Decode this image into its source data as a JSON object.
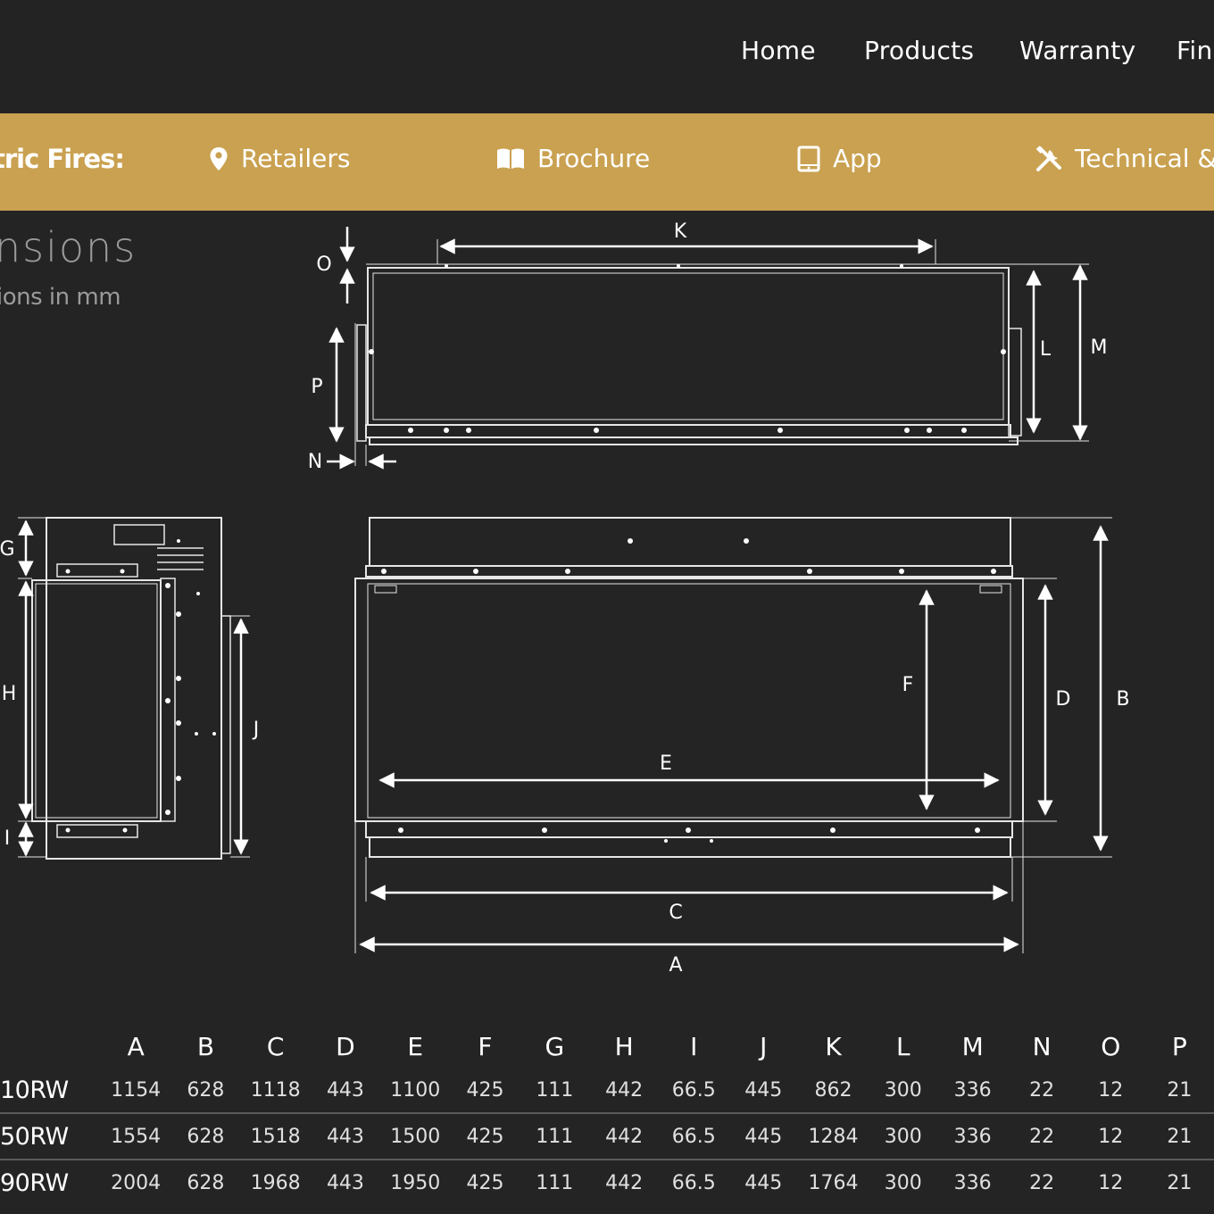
{
  "nav": {
    "home": "Home",
    "products": "Products",
    "warranty": "Warranty",
    "find": "Find"
  },
  "subnav": {
    "title": "tric Fires:",
    "retailers": "Retailers",
    "brochure": "Brochure",
    "app": "App",
    "technical": "Technical & S"
  },
  "section": {
    "heading": "nsions",
    "subheading": "ions in mm"
  },
  "diagram_labels": {
    "A": "A",
    "B": "B",
    "C": "C",
    "D": "D",
    "E": "E",
    "F": "F",
    "G": "G",
    "H": "H",
    "I": "I",
    "J": "J",
    "K": "K",
    "L": "L",
    "M": "M",
    "N": "N",
    "O": "O",
    "P": "P"
  },
  "table": {
    "headers": [
      "A",
      "B",
      "C",
      "D",
      "E",
      "F",
      "G",
      "H",
      "I",
      "J",
      "K",
      "L",
      "M",
      "N",
      "O",
      "P"
    ],
    "rows": [
      {
        "model": "10RW",
        "values": [
          "1154",
          "628",
          "1118",
          "443",
          "1100",
          "425",
          "111",
          "442",
          "66.5",
          "445",
          "862",
          "300",
          "336",
          "22",
          "12",
          "21"
        ]
      },
      {
        "model": "50RW",
        "values": [
          "1554",
          "628",
          "1518",
          "443",
          "1500",
          "425",
          "111",
          "442",
          "66.5",
          "445",
          "1284",
          "300",
          "336",
          "22",
          "12",
          "21"
        ]
      },
      {
        "model": "90RW",
        "values": [
          "2004",
          "628",
          "1968",
          "443",
          "1950",
          "425",
          "111",
          "442",
          "66.5",
          "445",
          "1764",
          "300",
          "336",
          "22",
          "12",
          "21"
        ]
      }
    ]
  },
  "colors": {
    "background": "#242424",
    "gold": "#c9a150",
    "text": "#ffffff",
    "muted": "#9a9a9a"
  }
}
